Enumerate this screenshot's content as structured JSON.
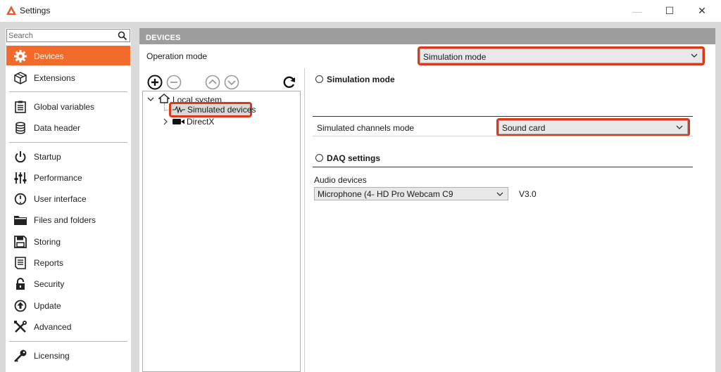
{
  "window": {
    "title": "Settings",
    "minimize": "—",
    "maximize": "☐",
    "close": "✕"
  },
  "sidebar": {
    "search_placeholder": "Search",
    "items": [
      {
        "label": "Devices",
        "icon": "gear-icon",
        "active": true
      },
      {
        "label": "Extensions",
        "icon": "cube-icon"
      },
      {
        "label": "Global variables",
        "icon": "list-icon"
      },
      {
        "label": "Data header",
        "icon": "database-icon"
      },
      {
        "label": "Startup",
        "icon": "power-icon"
      },
      {
        "label": "Performance",
        "icon": "sliders-icon"
      },
      {
        "label": "User interface",
        "icon": "gauge-icon"
      },
      {
        "label": "Files and folders",
        "icon": "folder-icon"
      },
      {
        "label": "Storing",
        "icon": "save-icon"
      },
      {
        "label": "Reports",
        "icon": "report-icon"
      },
      {
        "label": "Security",
        "icon": "lock-icon"
      },
      {
        "label": "Update",
        "icon": "update-icon"
      },
      {
        "label": "Advanced",
        "icon": "tools-icon"
      },
      {
        "label": "Licensing",
        "icon": "key-icon"
      }
    ]
  },
  "main": {
    "header": "DEVICES",
    "operation_mode_label": "Operation mode",
    "operation_mode_value": "Simulation mode",
    "tree": {
      "root": "Local system",
      "child_selected": "Simulated devices",
      "child2": "DirectX"
    },
    "simulation": {
      "title": "Simulation mode",
      "channels_label": "Simulated channels mode",
      "channels_value": "Sound card"
    },
    "daq": {
      "title": "DAQ settings",
      "audio_label": "Audio devices",
      "audio_value": "Microphone (4- HD Pro Webcam C9",
      "version": "V3.0"
    }
  },
  "colors": {
    "accent": "#f26b2a",
    "highlight_border": "#d8381c",
    "header_bg": "#9d9d9d",
    "frame": "#dadada"
  }
}
